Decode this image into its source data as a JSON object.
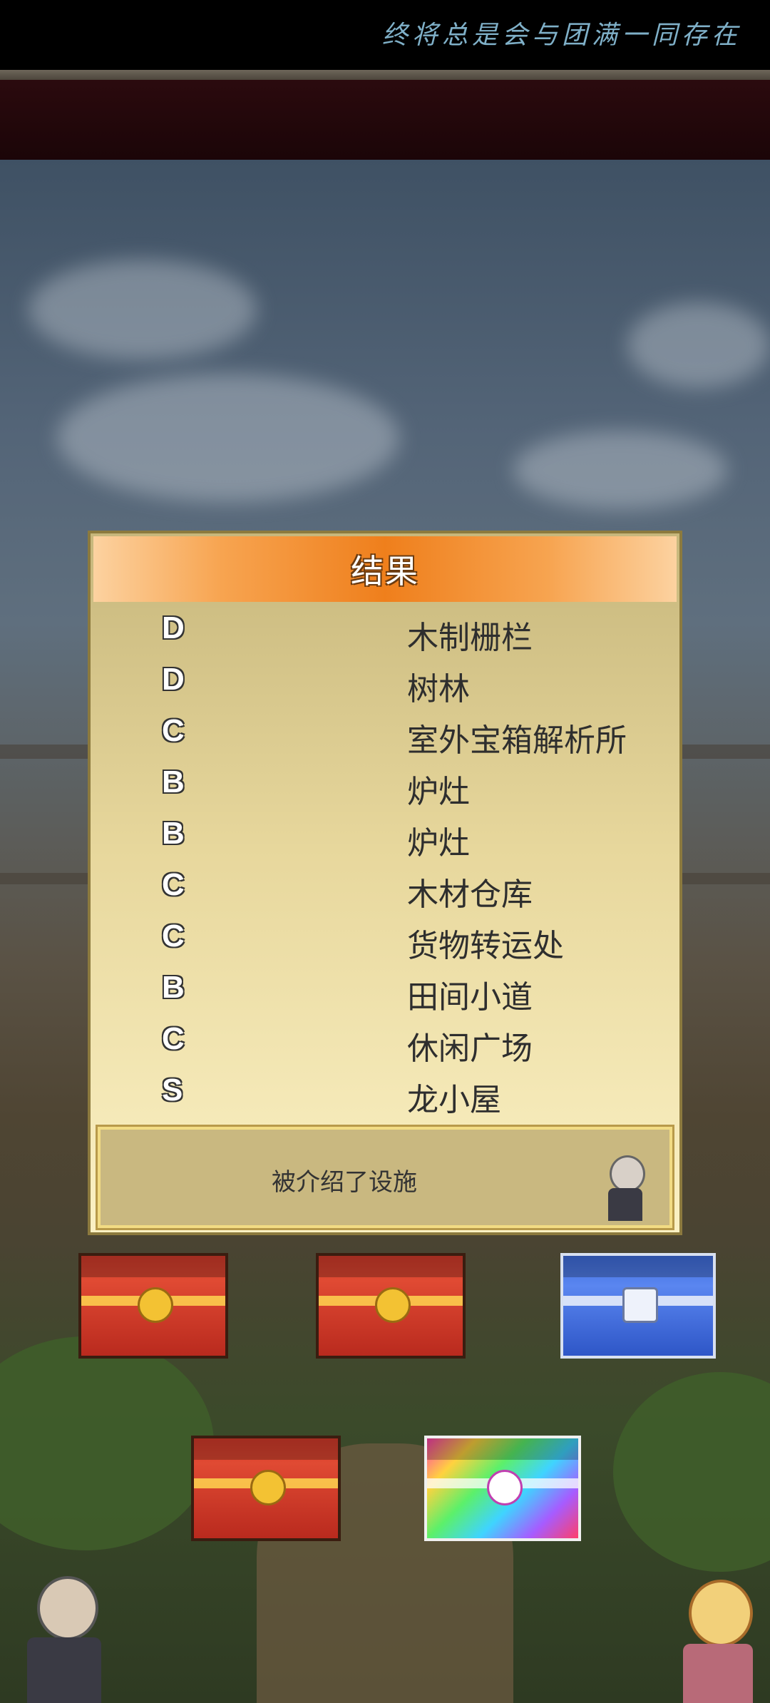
{
  "marquee_text": "终将总是会与团满一同存在",
  "dialog": {
    "title": "结果",
    "results": [
      {
        "grade": "D",
        "facility": "木制栅栏"
      },
      {
        "grade": "D",
        "facility": "树林"
      },
      {
        "grade": "C",
        "facility": "室外宝箱解析所"
      },
      {
        "grade": "B",
        "facility": "炉灶"
      },
      {
        "grade": "B",
        "facility": "炉灶"
      },
      {
        "grade": "C",
        "facility": "木材仓库"
      },
      {
        "grade": "C",
        "facility": "货物转运处"
      },
      {
        "grade": "B",
        "facility": "田间小道"
      },
      {
        "grade": "C",
        "facility": "休闲广场"
      },
      {
        "grade": "S",
        "facility": "龙小屋"
      }
    ],
    "message": "被介绍了设施"
  },
  "chests": [
    {
      "type": "red"
    },
    {
      "type": "red"
    },
    {
      "type": "blue"
    },
    {
      "type": "red"
    },
    {
      "type": "rainbow"
    }
  ],
  "colors": {
    "header_orange": "#ef7f1c",
    "panel_cream": "#fbf1c4",
    "chest_red": "#d73b2b",
    "chest_blue": "#3f6ee0"
  }
}
